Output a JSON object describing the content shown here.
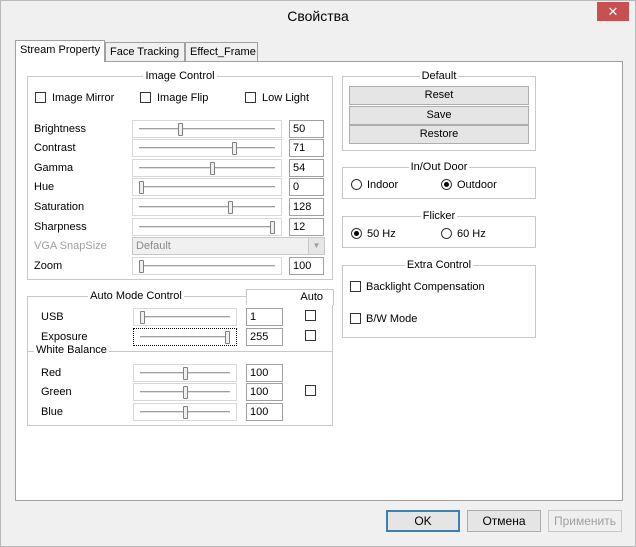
{
  "window": {
    "title": "Свойства",
    "close_glyph": "✕"
  },
  "tabs": [
    {
      "label": "Stream Property"
    },
    {
      "label": "Face Tracking"
    },
    {
      "label": "Effect_Frame"
    }
  ],
  "image_control": {
    "title": "Image Control",
    "checks": [
      {
        "label": "Image Mirror",
        "checked": false
      },
      {
        "label": "Image Flip",
        "checked": false
      },
      {
        "label": "Low Light",
        "checked": false
      }
    ],
    "sliders": [
      {
        "label": "Brightness",
        "value": "50",
        "position": 0.3
      },
      {
        "label": "Contrast",
        "value": "71",
        "position": 0.71
      },
      {
        "label": "Gamma",
        "value": "54",
        "position": 0.54
      },
      {
        "label": "Hue",
        "value": "0",
        "position": 0.0
      },
      {
        "label": "Saturation",
        "value": "128",
        "position": 0.68
      },
      {
        "label": "Sharpness",
        "value": "12",
        "position": 1.0
      }
    ],
    "vga_label": "VGA SnapSize",
    "vga_value": "Default",
    "zoom": {
      "label": "Zoom",
      "value": "100",
      "position": 0.0
    }
  },
  "auto_mode": {
    "title": "Auto Mode Control",
    "auto_header": "Auto",
    "rows": [
      {
        "label": "USB",
        "value": "1",
        "position": 0.0
      },
      {
        "label": "Exposure",
        "value": "255",
        "position": 1.0
      }
    ],
    "white_balance": {
      "title": "White Balance",
      "rows": [
        {
          "label": "Red",
          "value": "100",
          "position": 0.5
        },
        {
          "label": "Green",
          "value": "100",
          "position": 0.5
        },
        {
          "label": "Blue",
          "value": "100",
          "position": 0.5
        }
      ]
    }
  },
  "default_group": {
    "title": "Default",
    "buttons": [
      "Reset",
      "Save",
      "Restore"
    ]
  },
  "inout": {
    "title": "In/Out Door",
    "options": [
      {
        "label": "Indoor",
        "checked": false
      },
      {
        "label": "Outdoor",
        "checked": true
      }
    ]
  },
  "flicker": {
    "title": "Flicker",
    "options": [
      {
        "label": "50 Hz",
        "checked": true
      },
      {
        "label": "60 Hz",
        "checked": false
      }
    ]
  },
  "extra": {
    "title": "Extra Control",
    "checks": [
      {
        "label": "Backlight Compensation",
        "checked": false
      },
      {
        "label": "B/W Mode",
        "checked": false
      }
    ]
  },
  "footer": {
    "ok": "OK",
    "cancel": "Отмена",
    "apply": "Применить"
  }
}
